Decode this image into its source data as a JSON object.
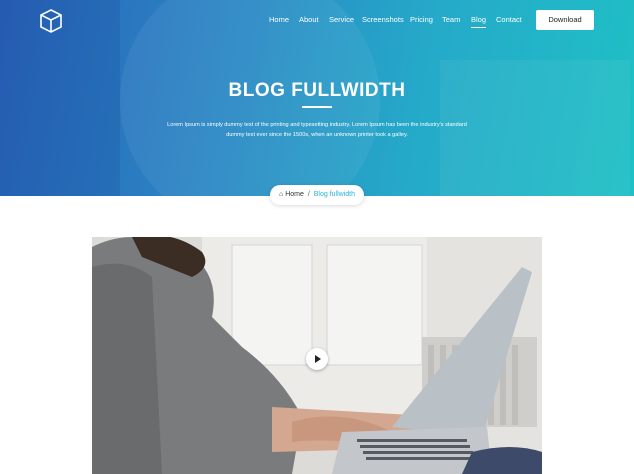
{
  "nav": {
    "items": [
      "Home",
      "About",
      "Service",
      "Screenshots",
      "Pricing",
      "Team",
      "Blog",
      "Contact"
    ],
    "active": "Blog",
    "download_label": "Download"
  },
  "logo": {
    "icon": "cube-logo-icon"
  },
  "hero": {
    "title": "BLOG FULLWIDTH",
    "text": "Lorem Ipsum is simply dummy text of the printing and typesetting industry. Lorem Ipsum has been the industry's standard dummy text ever since the 1500s, when an unknown printer took a galley."
  },
  "breadcrumb": {
    "home_icon": "home-icon",
    "home": "Home",
    "separator": "/",
    "current": "Blog fullwidth"
  },
  "video": {
    "play_icon": "play-icon"
  },
  "colors": {
    "gradient_start": "#2a63b9",
    "gradient_end": "#1fc0c6",
    "accent": "#2db2d6"
  }
}
